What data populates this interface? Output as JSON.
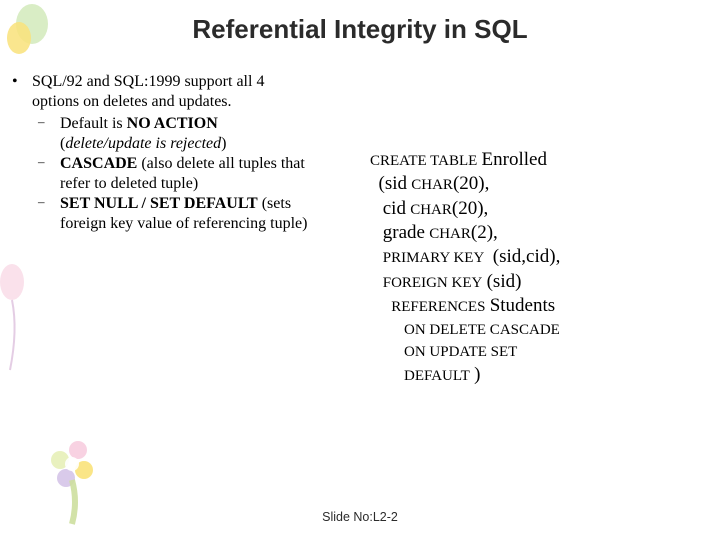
{
  "title": "Referential Integrity in SQL",
  "bullets": {
    "main_a": "SQL/92 and SQL:1999 support all 4",
    "main_b": "options on deletes and updates.",
    "sub1": {
      "pre": "Default is ",
      "bold": "NO ACTION",
      "ital": "delete/update is rejected"
    },
    "sub2": {
      "bold": "CASCADE",
      "tail_a": "  (also delete all tuples that",
      "tail_b": "refer to deleted tuple)"
    },
    "sub3": {
      "bold": "SET NULL / SET DEFAULT",
      "tail_a": "  (sets",
      "tail_b": "foreign key value of referencing tuple)"
    }
  },
  "sql": {
    "l1a": "CREATE TABLE",
    "l1b": "Enrolled",
    "l2a": "(sid",
    "l2b": "CHAR",
    "l2c": "(20),",
    "l3a": "cid",
    "l3b": "CHAR",
    "l3c": "(20),",
    "l4a": "grade",
    "l4b": "CHAR",
    "l4c": "(2),",
    "l5a": "PRIMARY KEY",
    "l5b": "(sid,cid),",
    "l6a": "FOREIGN KEY",
    "l6b": "(sid)",
    "l7a": "REFERENCES",
    "l7b": "Students",
    "l8": "ON DELETE CASCADE",
    "l9": "ON UPDATE SET",
    "l10a": "DEFAULT",
    "l10b": ")"
  },
  "footer": "Slide No:L2-2"
}
